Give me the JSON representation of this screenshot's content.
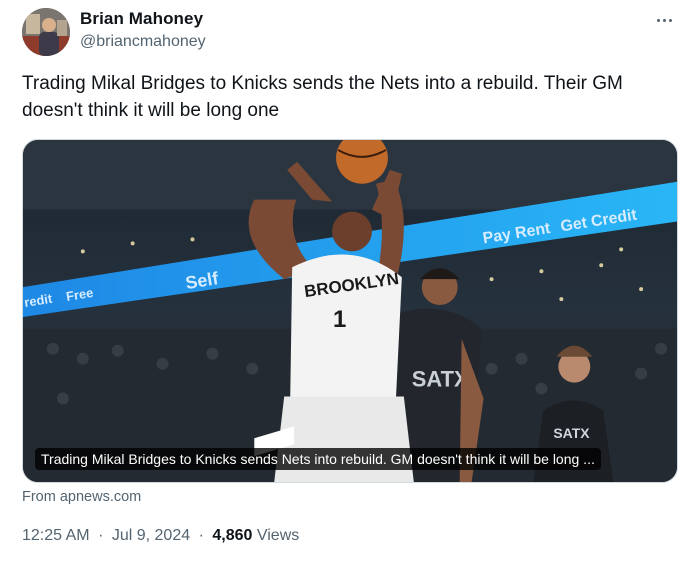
{
  "author": {
    "name": "Brian Mahoney",
    "handle": "@briancmahoney"
  },
  "tweet": {
    "text": "Trading Mikal Bridges to Knicks sends the Nets into a rebuild. Their GM doesn't think it will be long one"
  },
  "card": {
    "caption": "Trading Mikal Bridges to Knicks sends Nets into rebuild. GM doesn't think it will be long ...",
    "source": "From apnews.com",
    "jersey_front": "BROOKLYN",
    "jersey_number": "1",
    "defender_jersey": "SATX",
    "arena_banner": [
      "Pay Rent",
      "Get Credit",
      "Self",
      "redit",
      "Free"
    ]
  },
  "meta": {
    "time": "12:25 AM",
    "date": "Jul 9, 2024",
    "views_count": "4,860",
    "views_label": "Views",
    "separator": "·"
  },
  "icons": {
    "more": "more-horizontal-icon"
  },
  "colors": {
    "text": "#0f1419",
    "secondary": "#536471",
    "border": "#cfd9de",
    "banner": "#1f7fe0"
  }
}
